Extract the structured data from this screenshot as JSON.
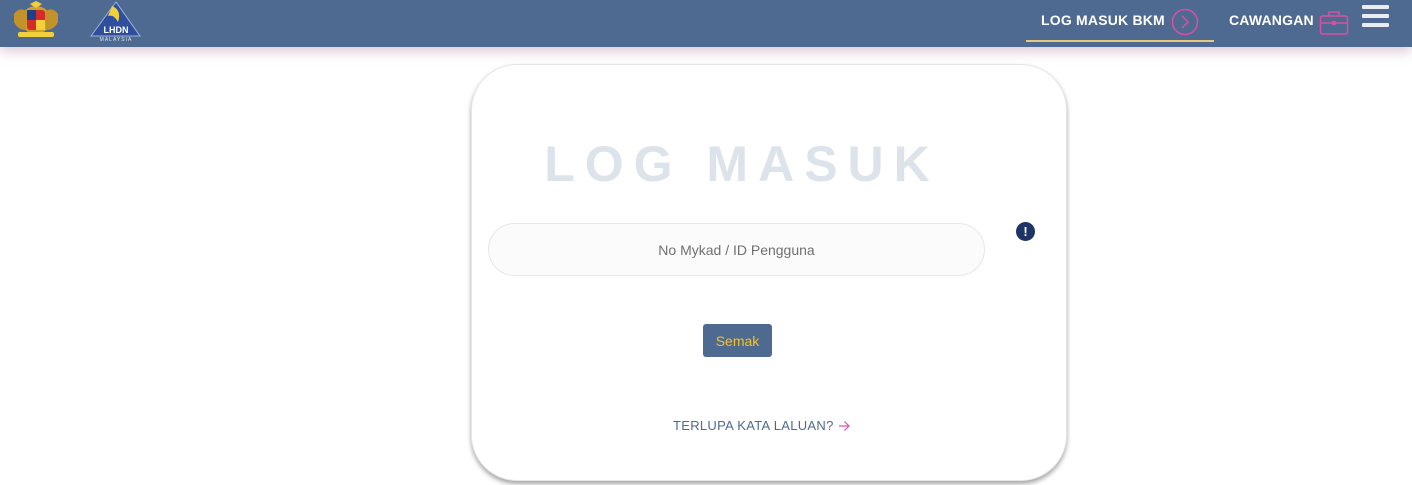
{
  "header": {
    "logos": [
      "crest-logo",
      "lhdn-logo"
    ],
    "lhdn_logo_text": "LHDN",
    "lhdn_logo_subtext": "MALAYSIA",
    "nav": {
      "bkm_label": "LOG MASUK BKM",
      "cawangan_label": "CAWANGAN"
    },
    "icons": {
      "bkm": "chevron-right-circle-icon",
      "cawangan": "briefcase-icon",
      "menu": "hamburger-menu-icon"
    },
    "colors": {
      "bar": "#4e6a91",
      "accent_pink": "#d94fa4",
      "underline": "#e8c97a"
    }
  },
  "login": {
    "title": "LOG MASUK",
    "id_placeholder": "No Mykad / ID Pengguna",
    "id_value": "",
    "info_icon": "!",
    "submit_label": "Semak",
    "forgot_label": "TERLUPA KATA LALUAN?"
  }
}
